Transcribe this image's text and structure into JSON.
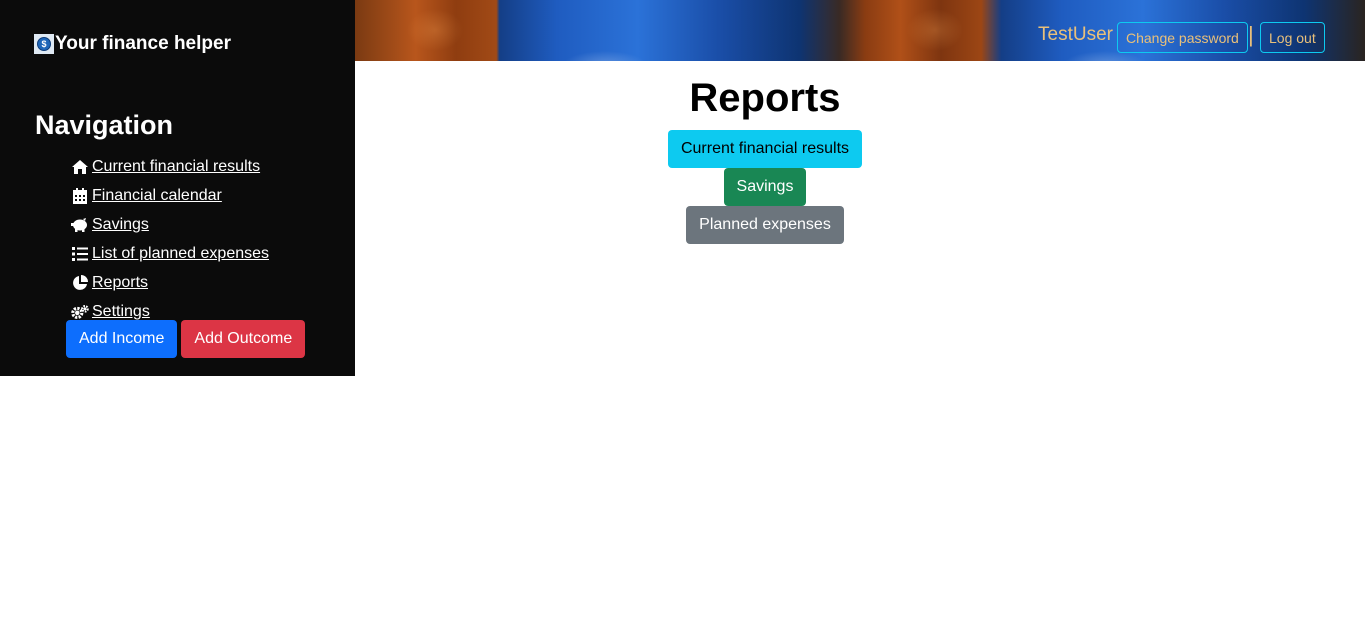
{
  "brand": {
    "title": "Your finance helper",
    "icon": "dollar-coin-icon",
    "coin_glyph": "$"
  },
  "sidebar": {
    "heading": "Navigation",
    "items": [
      {
        "label": " Current financial results",
        "icon": "home-icon"
      },
      {
        "label": " Financial calendar",
        "icon": "calendar-icon"
      },
      {
        "label": " Savings",
        "icon": "piggy-bank-icon"
      },
      {
        "label": " List of planned expenses",
        "icon": "list-icon"
      },
      {
        "label": " Reports",
        "icon": "pie-chart-icon"
      },
      {
        "label": " Settings",
        "icon": "gears-icon"
      }
    ],
    "add_income_label": "Add Income",
    "add_outcome_label": "Add Outcome"
  },
  "header": {
    "username": "TestUser",
    "change_password_label": "Change password",
    "separator": "|",
    "logout_label": "Log out"
  },
  "main": {
    "title": "Reports",
    "buttons": {
      "current_results": "Current financial results",
      "savings": "Savings",
      "planned_expenses": "Planned expenses"
    }
  },
  "colors": {
    "sidebar_bg": "#0b0b0b",
    "primary": "#0d6efd",
    "danger": "#dc3545",
    "info": "#0dcaf0",
    "success": "#198754",
    "secondary": "#6c757d",
    "header_text": "#e9c07a"
  }
}
